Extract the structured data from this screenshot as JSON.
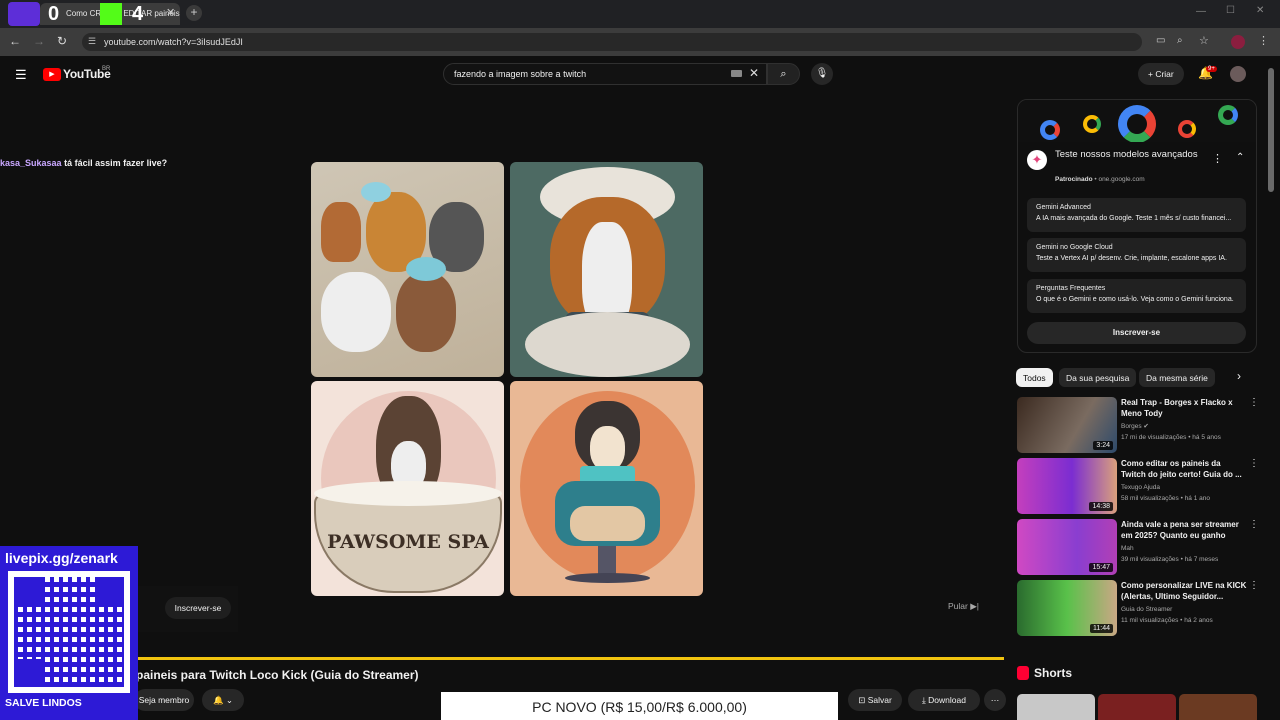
{
  "overlay": {
    "digit_left": "0",
    "digit_right": "4"
  },
  "browser": {
    "tab_title": "Como CRIAR e EDITAR painéis",
    "url": "youtube.com/watch?v=3iIsudJEdJI"
  },
  "youtube": {
    "logo_text": "YouTube",
    "region": "BR",
    "search_query": "fazendo a imagem sobre a twitch",
    "create_label": "Criar",
    "notif_count": "9+"
  },
  "chat": {
    "user": "kasa_Sukasaa",
    "message": "tá fácil assim fazer live?"
  },
  "video": {
    "spa_label": "PAWSOME SPA",
    "skip_label": "Pular",
    "subscribe_label": "Inscrever-se",
    "title": "paineis para Twitch Loco Kick (Guia do Streamer)",
    "join_label": "Seja membro",
    "save_label": "Salvar",
    "download_label": "Download"
  },
  "ad": {
    "title": "Teste nossos modelos avançados",
    "sponsored": "Patrocinado",
    "domain": "one.google.com",
    "rows": [
      {
        "title": "Gemini Advanced",
        "desc": "A IA mais avançada do Google. Teste 1 mês s/ custo financei..."
      },
      {
        "title": "Gemini no Google Cloud",
        "desc": "Teste a Vertex AI p/ desenv. Crie, implante, escalone apps IA."
      },
      {
        "title": "Perguntas Frequentes",
        "desc": "O que é o Gemini e como usá-lo. Veja como o Gemini funciona."
      }
    ],
    "cta": "Inscrever-se"
  },
  "chips": [
    "Todos",
    "Da sua pesquisa",
    "Da mesma série"
  ],
  "related": [
    {
      "title": "Real Trap - Borges x Flacko x Meno Tody",
      "channel": "Borges",
      "meta": "17 mi de visualizações • há 5 anos",
      "duration": "3:24"
    },
    {
      "title": "Como editar os paineis da Twitch do jeito certo! Guia do ...",
      "channel": "Texugo Ajuda",
      "meta": "58 mil visualizações • há 1 ano",
      "duration": "14:38"
    },
    {
      "title": "Ainda vale a pena ser streamer em 2025? Quanto eu ganho",
      "channel": "Mah",
      "meta": "39 mil visualizações • há 7 meses",
      "duration": "15:47"
    },
    {
      "title": "Como personalizar LIVE na KICK (Alertas, Ultimo Seguidor...",
      "channel": "Guia do Streamer",
      "meta": "11 mil visualizações • há 2 anos",
      "duration": "11:44"
    }
  ],
  "shorts_label": "Shorts",
  "stream_overlay": {
    "qr_url": "livepix.gg/zenark",
    "qr_caption": "SALVE LINDOS",
    "goal_text": "PC NOVO (R$ 15,00/R$ 6.000,00)"
  }
}
